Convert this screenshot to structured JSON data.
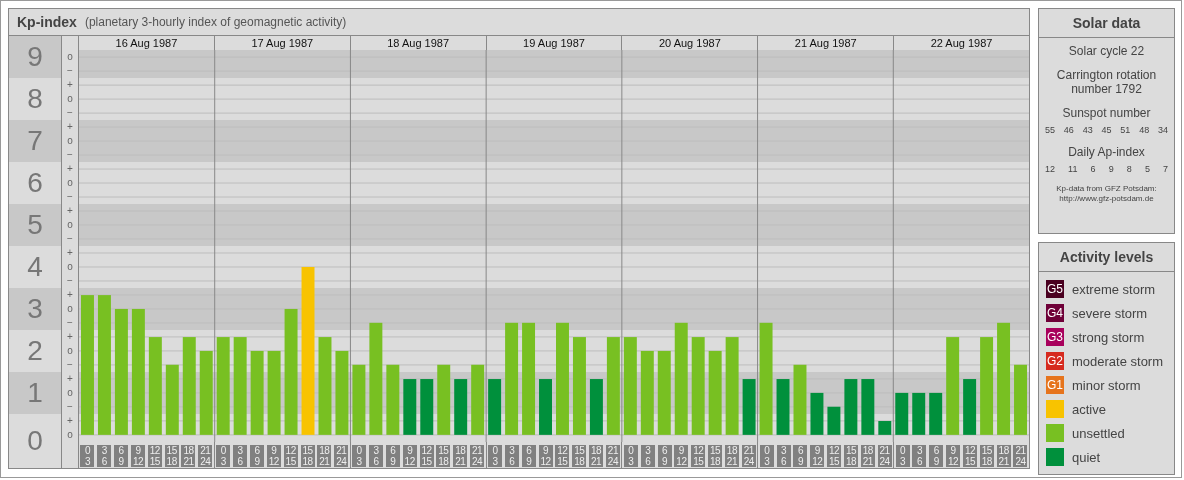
{
  "kp_panel": {
    "title": "Kp-index",
    "subtitle": "(planetary 3-hourly index of geomagnetic activity)",
    "sub_marks": [
      "o",
      "−",
      "+",
      "o",
      "−",
      "+",
      "o",
      "−",
      "+",
      "o",
      "−",
      "+",
      "o",
      "−",
      "+",
      "o",
      "−",
      "+",
      "o",
      "−",
      "+",
      "o",
      "−",
      "+",
      "o",
      "−",
      "+",
      "o"
    ],
    "dates": [
      "16 Aug 1987",
      "17 Aug 1987",
      "18 Aug 1987",
      "19 Aug 1987",
      "20 Aug 1987",
      "21 Aug 1987",
      "22 Aug 1987"
    ],
    "chart_data": {
      "type": "bar",
      "stacked": true,
      "grid": true,
      "ylim": [
        -0.17,
        9.17
      ],
      "yticks": [
        {
          "value": 9,
          "label": "9"
        },
        {
          "value": 8,
          "label": "8"
        },
        {
          "value": 7,
          "label": "7"
        },
        {
          "value": 6,
          "label": "6"
        },
        {
          "value": 5,
          "label": "5"
        },
        {
          "value": 4,
          "label": "4"
        },
        {
          "value": 3,
          "label": "3"
        },
        {
          "value": 2,
          "label": "2"
        },
        {
          "value": 1,
          "label": "1"
        },
        {
          "value": 0,
          "label": "0"
        }
      ],
      "categories": [
        "0 3",
        "3 6",
        "6 9",
        "9 12",
        "12 15",
        "15 18",
        "18 21",
        "21 24",
        "0 3",
        "3 6",
        "6 9",
        "9 12",
        "12 15",
        "15 18",
        "18 21",
        "21 24",
        "0 3",
        "3 6",
        "6 9",
        "9 12",
        "12 15",
        "15 18",
        "18 21",
        "21 24",
        "0 3",
        "3 6",
        "6 9",
        "9 12",
        "12 15",
        "15 18",
        "18 21",
        "21 24",
        "0 3",
        "3 6",
        "6 9",
        "9 12",
        "12 15",
        "15 18",
        "18 21",
        "21 24",
        "0 3",
        "3 6",
        "6 9",
        "9 12",
        "12 15",
        "15 18",
        "18 21",
        "21 24",
        "0 3",
        "3 6",
        "6 9",
        "9 12",
        "12 15",
        "15 18",
        "18 21",
        "21 24"
      ],
      "series": [
        {
          "color": "#00903c",
          "values": [
            null,
            null,
            null,
            null,
            null,
            null,
            null,
            null,
            null,
            null,
            null,
            null,
            null,
            null,
            null,
            null,
            null,
            null,
            null,
            1.33,
            1.33,
            null,
            1.33,
            null,
            1.33,
            null,
            null,
            1.33,
            null,
            null,
            1.33,
            null,
            null,
            null,
            null,
            null,
            null,
            null,
            null,
            1.33,
            null,
            1.33,
            null,
            1,
            0.67,
            1.33,
            1.33,
            0.33,
            1,
            1,
            1,
            null,
            1.33,
            null,
            null,
            null
          ]
        },
        {
          "color": "#78c022",
          "values": [
            3.33,
            3.33,
            3,
            3,
            2.33,
            1.67,
            2.33,
            2,
            2.33,
            2.33,
            2,
            2,
            3,
            null,
            2.33,
            2,
            1.67,
            2.67,
            1.67,
            null,
            null,
            1.67,
            null,
            1.67,
            null,
            2.67,
            2.67,
            null,
            2.67,
            2.33,
            null,
            2.33,
            2.33,
            2,
            2,
            2.67,
            2.33,
            2,
            2.33,
            null,
            2.67,
            null,
            1.67,
            null,
            null,
            null,
            null,
            null,
            null,
            null,
            null,
            2.33,
            null,
            2.33,
            2.67,
            1.67
          ]
        },
        {
          "color": "#f8c300",
          "values": [
            null,
            null,
            null,
            null,
            null,
            null,
            null,
            null,
            null,
            null,
            null,
            null,
            null,
            4,
            null,
            null,
            null,
            null,
            null,
            null,
            null,
            null,
            null,
            null,
            null,
            null,
            null,
            null,
            null,
            null,
            null,
            null,
            null,
            null,
            null,
            null,
            null,
            null,
            null,
            null,
            null,
            null,
            null,
            null,
            null,
            null,
            null,
            null,
            null,
            null,
            null,
            null,
            null,
            null,
            null,
            null
          ]
        }
      ]
    }
  },
  "solar_data": {
    "title": "Solar data",
    "solar_cycle": "Solar cycle 22",
    "carrington": "Carrington rotation number 1792",
    "sunspot_heading": "Sunspot number",
    "sunspot_numbers": [
      "55",
      "46",
      "43",
      "45",
      "51",
      "48",
      "34"
    ],
    "ap_heading": "Daily Ap-index",
    "ap_values": [
      "12",
      "11",
      "6",
      "9",
      "8",
      "5",
      "7"
    ],
    "source": "Kp-data from GFZ Potsdam:",
    "source_url": "http://www.gfz-potsdam.de"
  },
  "legend": {
    "title": "Activity levels",
    "items": [
      {
        "badge": "G5",
        "label": "extreme storm",
        "color": "#4a0020"
      },
      {
        "badge": "G4",
        "label": "severe storm",
        "color": "#6e0038"
      },
      {
        "badge": "G3",
        "label": "strong storm",
        "color": "#a8005c"
      },
      {
        "badge": "G2",
        "label": "moderate storm",
        "color": "#d62a1e"
      },
      {
        "badge": "G1",
        "label": "minor storm",
        "color": "#e6741c"
      },
      {
        "label": "active",
        "color": "#f8c300"
      },
      {
        "label": "unsettled",
        "color": "#78c022"
      },
      {
        "label": "quiet",
        "color": "#00903c"
      }
    ]
  }
}
